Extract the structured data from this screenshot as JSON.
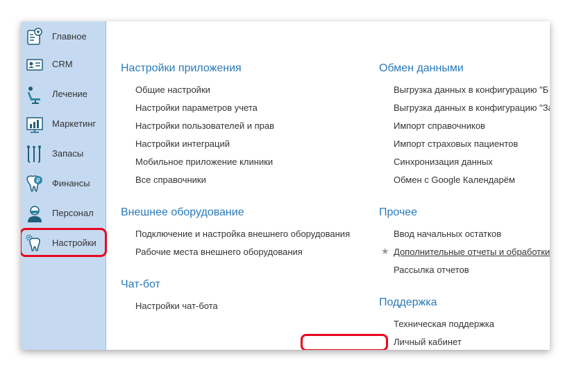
{
  "sidebar": {
    "items": [
      {
        "label": "Главное",
        "icon": "dashboard-icon"
      },
      {
        "label": "CRM",
        "icon": "crm-card-icon"
      },
      {
        "label": "Лечение",
        "icon": "dental-chair-icon"
      },
      {
        "label": "Маркетинг",
        "icon": "marketing-chart-icon"
      },
      {
        "label": "Запасы",
        "icon": "dental-tools-icon"
      },
      {
        "label": "Финансы",
        "icon": "tooth-coin-icon"
      },
      {
        "label": "Персонал",
        "icon": "doctor-icon"
      },
      {
        "label": "Настройки",
        "icon": "tooth-gear-icon"
      }
    ],
    "active": "Настройки"
  },
  "sections": {
    "app_settings": {
      "title": "Настройки приложения",
      "links": [
        "Общие настройки",
        "Настройки параметров учета",
        "Настройки пользователей и прав",
        "Настройки интеграций",
        "Мобильное приложение клиники",
        "Все справочники"
      ]
    },
    "external_equipment": {
      "title": "Внешнее оборудование",
      "links": [
        "Подключение и настройка внешнего оборудования",
        "Рабочие места внешнего оборудования"
      ]
    },
    "chatbot": {
      "title": "Чат-бот",
      "links": [
        "Настройки чат-бота"
      ]
    },
    "data_exchange": {
      "title": "Обмен данными",
      "links": [
        "Выгрузка данных в конфигурацию \"Б",
        "Выгрузка данных в конфигурацию \"За",
        "Импорт справочников",
        "Импорт страховых пациентов",
        "Синхронизация данных",
        "Обмен с Google Календарём"
      ]
    },
    "other": {
      "title": "Прочее",
      "links": [
        "Ввод начальных остатков",
        "Дополнительные отчеты и обработки",
        "Рассылка отчетов"
      ]
    },
    "support": {
      "title": "Поддержка",
      "links": [
        "Техническая поддержка",
        "Личный кабинет"
      ]
    }
  },
  "colors": {
    "accent": "#2a7ab8",
    "highlight": "#e8061c",
    "sidebar_bg": "#c5d9f1"
  }
}
